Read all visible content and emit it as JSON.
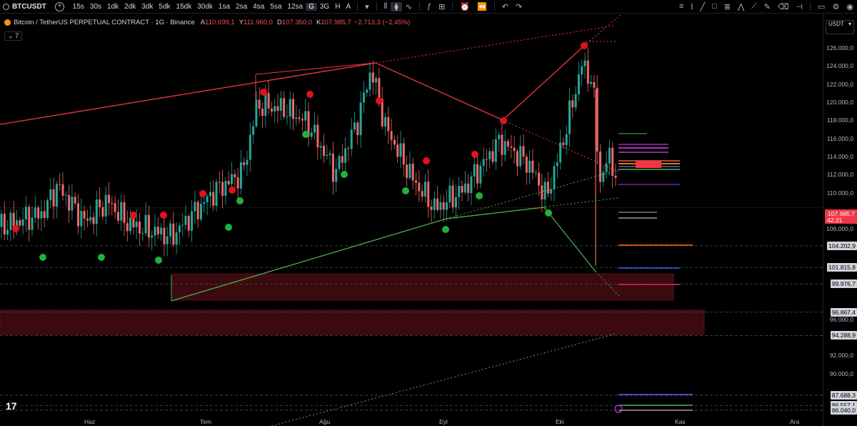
{
  "toolbar": {
    "symbol": "BTCUSDT",
    "add": "+",
    "timeframes": [
      "15s",
      "30s",
      "1dk",
      "2dk",
      "3dk",
      "5dk",
      "15dk",
      "30dk",
      "1sa",
      "2sa",
      "4sa",
      "5sa",
      "12sa",
      "G",
      "3G",
      "H",
      "A"
    ],
    "active_timeframe": "G"
  },
  "legend": {
    "title": "Bitcoin / TetherUS PERPETUAL CONTRACT · 1G · Binance",
    "o_label": "A",
    "o": "110.699,1",
    "h_label": "Y",
    "h": "111.960,0",
    "l_label": "D",
    "l": "107.350,0",
    "c_label": "K",
    "c": "107.985,7",
    "change": "−2.713,3 (−2,45%)",
    "indicators_count": "7"
  },
  "axis": {
    "currency": "USDT",
    "labels": [
      {
        "v": 126000,
        "t": "126.000,0"
      },
      {
        "v": 124000,
        "t": "124.000,0"
      },
      {
        "v": 122000,
        "t": "122.000,0"
      },
      {
        "v": 120000,
        "t": "120.000,0"
      },
      {
        "v": 118000,
        "t": "118.000,0"
      },
      {
        "v": 116000,
        "t": "116.000,0"
      },
      {
        "v": 114000,
        "t": "114.000,0"
      },
      {
        "v": 112000,
        "t": "112.000,0"
      },
      {
        "v": 110000,
        "t": "110.000,0"
      },
      {
        "v": 106000,
        "t": "106.000,0"
      },
      {
        "v": 96000,
        "t": "96.000,0"
      },
      {
        "v": 92000,
        "t": "92.000,0"
      },
      {
        "v": 90000,
        "t": "90.000,0"
      }
    ],
    "current_price": "107.985,7",
    "countdown": "42:21",
    "levels": [
      {
        "v": 104202.9,
        "t": "104.202,9"
      },
      {
        "v": 101815.8,
        "t": "101.815,8"
      },
      {
        "v": 99976.7,
        "t": "99.976,7"
      },
      {
        "v": 96867.4,
        "t": "96.867,4"
      },
      {
        "v": 94288.9,
        "t": "94.288,9"
      },
      {
        "v": 87688.3,
        "t": "87.688,3"
      },
      {
        "v": 86557.1,
        "t": "86.557,1"
      },
      {
        "v": 86040.0,
        "t": "86.040,0"
      }
    ]
  },
  "x_axis": [
    "Haz",
    "Tem",
    "Ağu",
    "Eyl",
    "Eki",
    "Kas",
    "Ara"
  ],
  "colors": {
    "up": "#26a69a",
    "down": "#f06868",
    "bear_line": "#f23645",
    "bull_line": "#4caf50",
    "zone": "#3b0a0f"
  }
}
